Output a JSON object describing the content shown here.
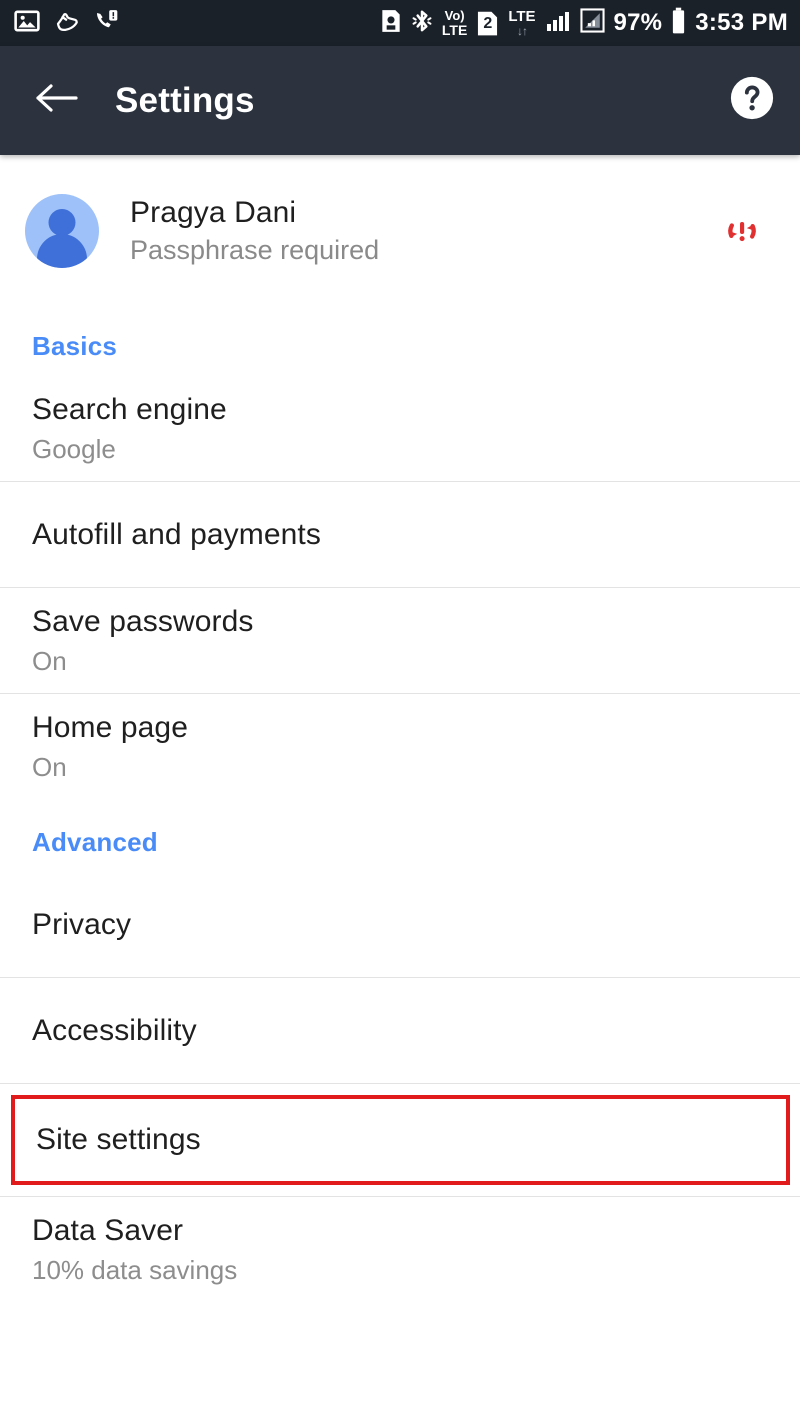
{
  "status_bar": {
    "left_icons": [
      "photo-icon",
      "shoe-icon",
      "missed-call-icon"
    ],
    "right_icons": [
      "sync-android-icon",
      "bluetooth-icon",
      "volte-icon",
      "sim2-icon",
      "lte-data-icon",
      "signal-bars-icon",
      "signal-secondary-icon"
    ],
    "volte_top": "Vo)",
    "volte_bottom": "LTE",
    "sim_label": "2",
    "lte_label": "LTE",
    "battery_percent": "97%",
    "clock": "3:53 PM"
  },
  "app_bar": {
    "back_icon": "back-arrow-icon",
    "title": "Settings",
    "help_icon": "help-circle-icon"
  },
  "account": {
    "avatar_icon": "person-avatar-icon",
    "name": "Pragya Dani",
    "status": "Passphrase required",
    "sync_error_icon": "sync-problem-icon"
  },
  "sections": [
    {
      "header": "Basics",
      "items": [
        {
          "title": "Search engine",
          "subtitle": "Google"
        },
        {
          "title": "Autofill and payments",
          "subtitle": ""
        },
        {
          "title": "Save passwords",
          "subtitle": "On"
        },
        {
          "title": "Home page",
          "subtitle": "On"
        }
      ]
    },
    {
      "header": "Advanced",
      "items": [
        {
          "title": "Privacy",
          "subtitle": ""
        },
        {
          "title": "Accessibility",
          "subtitle": ""
        },
        {
          "title": "Site settings",
          "subtitle": "",
          "highlighted": true
        },
        {
          "title": "Data Saver",
          "subtitle": "10% data savings"
        }
      ]
    }
  ],
  "colors": {
    "status_bar_bg": "#1b2129",
    "app_bar_bg": "#2c333e",
    "section_header": "#4a8cf7",
    "highlight_border": "#e11b1b",
    "sync_error": "#e03030",
    "avatar_bg": "#9dc1f8",
    "avatar_figure": "#3f6fd8",
    "divider": "#e3e3e3",
    "title_text": "#1f1f1f",
    "subtitle_text": "#8d8d8d"
  }
}
